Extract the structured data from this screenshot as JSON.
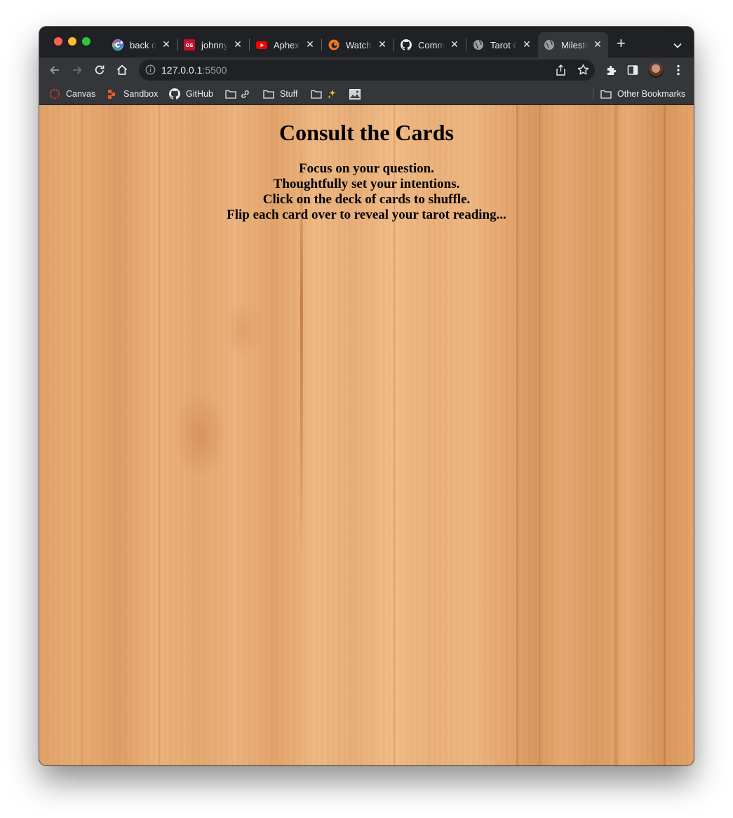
{
  "browser": {
    "tabs": [
      {
        "label": "back o",
        "icon": "google-icon",
        "active": false
      },
      {
        "label": "johnny",
        "icon": "os-icon",
        "active": false
      },
      {
        "label": "Aphex",
        "icon": "youtube-icon",
        "active": false
      },
      {
        "label": "Watch",
        "icon": "crunchyroll-icon",
        "active": false
      },
      {
        "label": "Comm",
        "icon": "github-icon",
        "active": false
      },
      {
        "label": "Tarot C",
        "icon": "globe-icon",
        "active": false
      },
      {
        "label": "Milesto",
        "icon": "globe-icon",
        "active": true
      }
    ],
    "address": {
      "host": "127.0.0.1",
      "port": ":5500"
    },
    "bookmarks": [
      {
        "label": "Canvas",
        "icon": "canvas-icon"
      },
      {
        "label": "Sandbox",
        "icon": "sandbox-icon"
      },
      {
        "label": "GitHub",
        "icon": "github-icon"
      },
      {
        "label": "",
        "icon": "folder-link-icon"
      },
      {
        "label": "Stuff",
        "icon": "folder-icon"
      },
      {
        "label": "",
        "icon": "folder-sparkles-icon"
      },
      {
        "label": "",
        "icon": "image-icon"
      }
    ],
    "other_bookmarks": "Other Bookmarks"
  },
  "page": {
    "title": "Consult the Cards",
    "instructions": [
      "Focus on your question.",
      "Thoughtfully set your intentions.",
      "Click on the deck of cards to shuffle.",
      "Flip each card over to reveal your tarot reading..."
    ]
  },
  "colors": {
    "chrome_dark": "#202124",
    "chrome_toolbar": "#35363a",
    "wood_base": "#e9ae74"
  }
}
